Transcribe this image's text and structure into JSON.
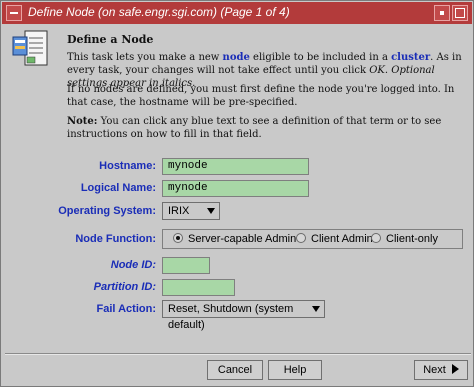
{
  "window": {
    "title": "Define Node (on safe.engr.sgi.com) (Page 1 of 4)"
  },
  "header": {
    "heading": "Define a Node"
  },
  "intro": {
    "p1": {
      "a": "This task lets you make a new ",
      "kw1": "node",
      "b": " eligible to be included in a ",
      "kw2": "cluster",
      "c": ". As in every task, your changes will not take effect until you click ",
      "ok": "OK",
      "d": ". ",
      "optional": "Optional settings appear in italics."
    },
    "p2": "If no nodes are defined, you must first define the node you're logged into. In that case, the hostname will be pre-specified.",
    "p3": {
      "note": "Note:",
      "text": " You can click any blue text to see a definition of that term or to see instructions on how to fill in that field."
    }
  },
  "form": {
    "hostname_label": "Hostname:",
    "hostname_value": "mynode",
    "logical_name_label": "Logical Name:",
    "logical_name_value": "mynode",
    "os_label": "Operating System:",
    "os_value": "IRIX",
    "node_function_label": "Node Function:",
    "node_function_options": [
      "Server-capable Admin",
      "Client Admin",
      "Client-only"
    ],
    "node_function_selected": "Server-capable Admin",
    "node_id_label": "Node ID:",
    "node_id_value": "",
    "partition_id_label": "Partition ID:",
    "partition_id_value": "",
    "fail_action_label": "Fail Action:",
    "fail_action_value": "Reset, Shutdown (system default)"
  },
  "footer": {
    "cancel": "Cancel",
    "help": "Help",
    "next": "Next"
  },
  "colors": {
    "title_bar": "#b33b3b",
    "link_text": "#1a2db7",
    "field_bg": "#a8d7a6",
    "window_bg": "#c9c9c9"
  }
}
